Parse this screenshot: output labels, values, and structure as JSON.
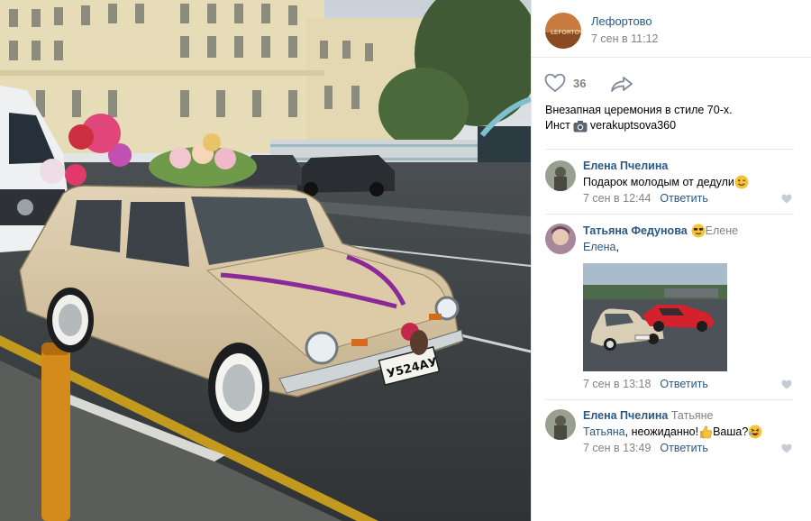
{
  "post": {
    "author": "Лефортово",
    "time": "7 сен в 11:12",
    "likes": "36",
    "text_line1": "Внезапная церемония в стиле 70-х.",
    "text_prefix": "Инст",
    "text_handle": "verakuptsova360",
    "plate": "У524АУ"
  },
  "comments": [
    {
      "author": "Елена Пчелина",
      "to": "",
      "text": "Подарок молодым от дедули",
      "emoji": "wink-emoji",
      "time": "7 сен в 12:44",
      "reply": "Ответить"
    },
    {
      "author": "Татьяна Федунова",
      "to": "Елене",
      "lead_emoji": "cool-emoji",
      "text_link": "Елена",
      "text": ",",
      "time": "7 сен в 13:18",
      "reply": "Ответить"
    },
    {
      "author": "Елена Пчелина",
      "to": "Татьяне",
      "text_link": "Татьяна",
      "text": ", неожиданно!",
      "text2": " Ваша?",
      "emoji": "thumbs-up-emoji",
      "emoji2": "rofl-emoji",
      "time": "7 сен в 13:49",
      "reply": "Ответить"
    }
  ],
  "colors": {
    "link": "#2a5885",
    "muted": "#828282",
    "divider": "#e7e8ec",
    "car_body": "#d8c5a3",
    "ribbon": "#8a2a9a"
  }
}
